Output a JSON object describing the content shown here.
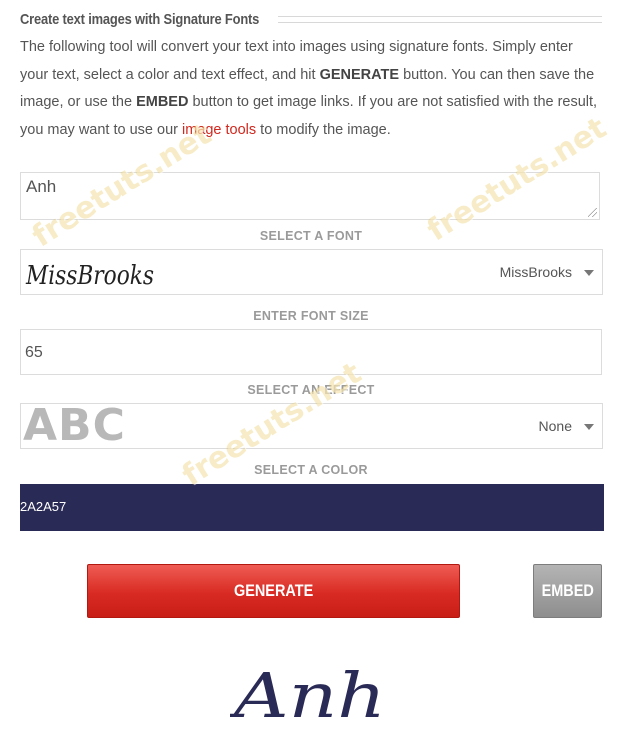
{
  "heading": {
    "title": "Create text images with Signature Fonts"
  },
  "intro": {
    "part1": "The following tool will convert your text into images using signature fonts. Simply enter your text, select a color and text effect, and hit ",
    "generate_word": "GENERATE",
    "part2": " button. You can then save the image, or use the ",
    "embed_word": "EMBED",
    "part3": " button to get image links. If you are not satisfied with the result, you may want to use our ",
    "link_text": "image tools",
    "part4": " to modify the image."
  },
  "text_input": {
    "value": "Anh"
  },
  "font_select": {
    "label": "SELECT A FONT",
    "preview_text": "MissBrooks",
    "value": "MissBrooks"
  },
  "font_size": {
    "label": "ENTER FONT SIZE",
    "value": "65"
  },
  "effect_select": {
    "label": "SELECT AN EFFECT",
    "preview_text": "ABC",
    "value": "None"
  },
  "color": {
    "label": "SELECT A COLOR",
    "value": "2A2A57",
    "hex": "#2A2A57"
  },
  "buttons": {
    "generate": "GENERATE",
    "embed": "EMBED"
  },
  "result": {
    "text": "Anh",
    "color": "#2A2A57"
  },
  "watermarks": [
    "freetuts.net",
    "freetuts.net",
    "freetuts.net"
  ],
  "colors": {
    "accent": "#D0281E",
    "generate_bg": "#DB2C23",
    "embed_bg": "#9E9E9E"
  }
}
